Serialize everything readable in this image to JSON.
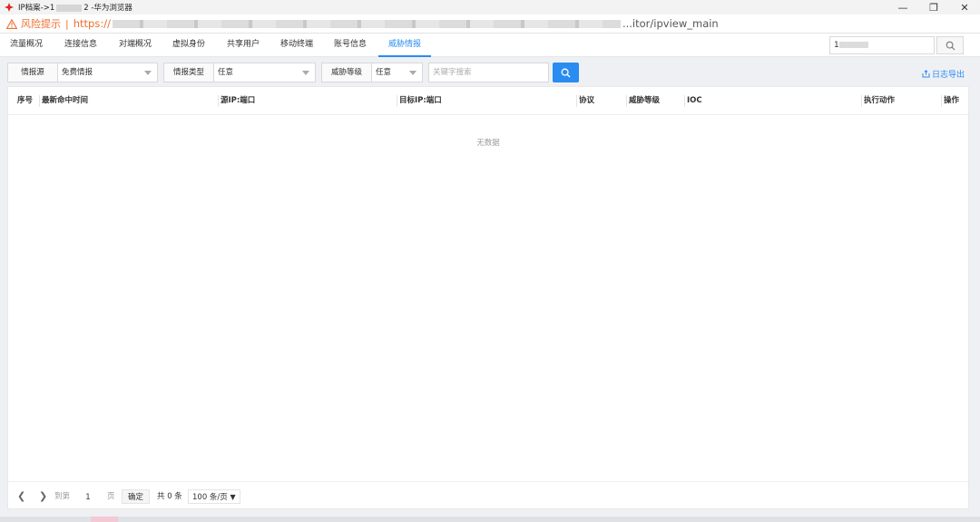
{
  "window": {
    "title_prefix": "IP档案->1",
    "title_suffix": "2 -华为浏览器",
    "controls": {
      "minimize": "—",
      "restore": "❐",
      "close": "✕"
    }
  },
  "address_bar": {
    "risk_label": "风险提示",
    "separator": "|",
    "url_scheme": "https://",
    "url_tail": "...itor/ipview_main"
  },
  "nav": {
    "tabs": [
      {
        "label": "流量概况"
      },
      {
        "label": "连接信息"
      },
      {
        "label": "对端概况"
      },
      {
        "label": "虚拟身份"
      },
      {
        "label": "共享用户"
      },
      {
        "label": "移动终端"
      },
      {
        "label": "账号信息"
      },
      {
        "label": "威胁情报"
      }
    ],
    "active_tab": "威胁情报",
    "search_value": "1"
  },
  "filters": {
    "source": {
      "label": "情报源",
      "value": "免费情报"
    },
    "type": {
      "label": "情报类型",
      "value": "任意"
    },
    "level": {
      "label": "威胁等级",
      "value": "任意"
    },
    "keyword_placeholder": "关键字搜索",
    "export_label": "日志导出"
  },
  "table": {
    "columns": [
      {
        "label": "序号"
      },
      {
        "label": "最新命中时间"
      },
      {
        "label": "源IP:端口"
      },
      {
        "label": "目标IP:端口"
      },
      {
        "label": "协议"
      },
      {
        "label": "威胁等级"
      },
      {
        "label": "IOC"
      },
      {
        "label": "执行动作"
      },
      {
        "label": "操作"
      }
    ],
    "rows": [],
    "empty_text": "无数据"
  },
  "pagination": {
    "goto_label": "到第",
    "page_value": "1",
    "page_unit": "页",
    "confirm_label": "确定",
    "total_text": "共 0 条",
    "page_size": "100 条/页"
  },
  "colors": {
    "accent": "#2a8cf0",
    "warning": "#ee6f2d"
  }
}
